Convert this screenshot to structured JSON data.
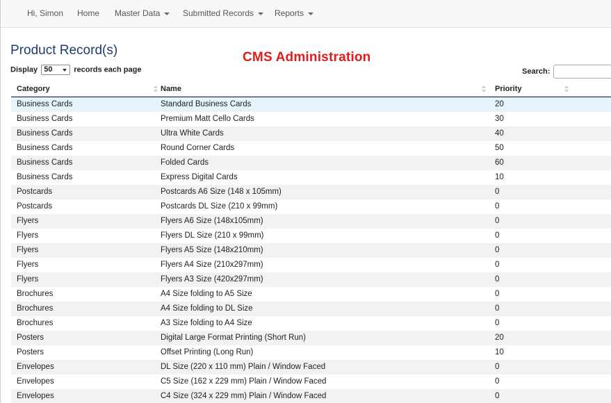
{
  "nav": {
    "greeting": "Hi, Simon",
    "home": "Home",
    "master_data": "Master Data",
    "submitted_records": "Submitted Records",
    "reports": "Reports"
  },
  "page": {
    "title": "Product Record(s)",
    "overlay_title": "CMS Administration"
  },
  "length_menu": {
    "prefix": "Display",
    "value": "50",
    "suffix": "records each page"
  },
  "search": {
    "label": "Search:",
    "value": ""
  },
  "table": {
    "columns": [
      "Category",
      "Name",
      "Priority"
    ],
    "rows": [
      [
        "Business Cards",
        "Standard Business Cards",
        "20"
      ],
      [
        "Business Cards",
        "Premium Matt Cello Cards",
        "30"
      ],
      [
        "Business Cards",
        "Ultra White Cards",
        "40"
      ],
      [
        "Business Cards",
        "Round Corner Cards",
        "50"
      ],
      [
        "Business Cards",
        "Folded Cards",
        "60"
      ],
      [
        "Business Cards",
        "Express Digital Cards",
        "10"
      ],
      [
        "Postcards",
        "Postcards A6 Size (148 x 105mm)",
        "0"
      ],
      [
        "Postcards",
        "Postcards DL Size (210 x 99mm)",
        "0"
      ],
      [
        "Flyers",
        "Flyers A6 Size (148x105mm)",
        "0"
      ],
      [
        "Flyers",
        "Flyers DL Size (210 x 99mm)",
        "0"
      ],
      [
        "Flyers",
        "Flyers A5 Size (148x210mm)",
        "0"
      ],
      [
        "Flyers",
        "Flyers A4 Size (210x297mm)",
        "0"
      ],
      [
        "Flyers",
        "Flyers A3 Size (420x297mm)",
        "0"
      ],
      [
        "Brochures",
        "A4 Size folding to A5 Size",
        "0"
      ],
      [
        "Brochures",
        "A4 Size folding to DL Size",
        "0"
      ],
      [
        "Brochures",
        "A3 Size folding to A4 Size",
        "0"
      ],
      [
        "Posters",
        "Digital Large Format Printing (Short Run)",
        "20"
      ],
      [
        "Posters",
        "Offset Printing (Long Run)",
        "10"
      ],
      [
        "Envelopes",
        "DL Size (220 x 110 mm) Plain / Window Faced",
        "0"
      ],
      [
        "Envelopes",
        "C5 Size (162 x 229 mm) Plain / Window Faced",
        "0"
      ],
      [
        "Envelopes",
        "C4 Size (324 x 229 mm) Plain / Window Faced",
        "0"
      ]
    ]
  },
  "colors": {
    "title": "#1f3b70",
    "overlay": "#e21b1b",
    "selected_row": "#e6f3fb",
    "striped_row": "#f2f2f2"
  },
  "icons": [
    "caret-down-icon",
    "sort-icon"
  ]
}
